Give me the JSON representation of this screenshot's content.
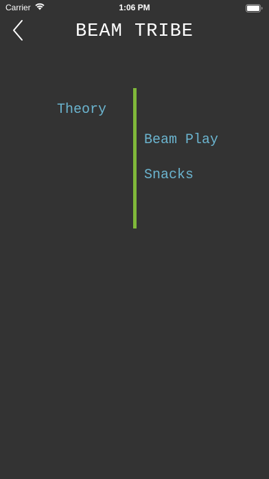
{
  "status_bar": {
    "carrier": "Carrier",
    "time": "1:06 PM",
    "wifi_icon": "wifi-icon",
    "battery_icon": "battery-icon"
  },
  "nav": {
    "title": "BEAM TRIBE",
    "back_icon": "chevron-left-icon"
  },
  "menu": {
    "items": [
      {
        "label": "Theory"
      },
      {
        "label": "Beam Play"
      },
      {
        "label": "Snacks"
      }
    ]
  },
  "colors": {
    "background": "#333333",
    "link": "#6bb4cf",
    "divider": "#7fb83a",
    "text": "#ffffff"
  }
}
